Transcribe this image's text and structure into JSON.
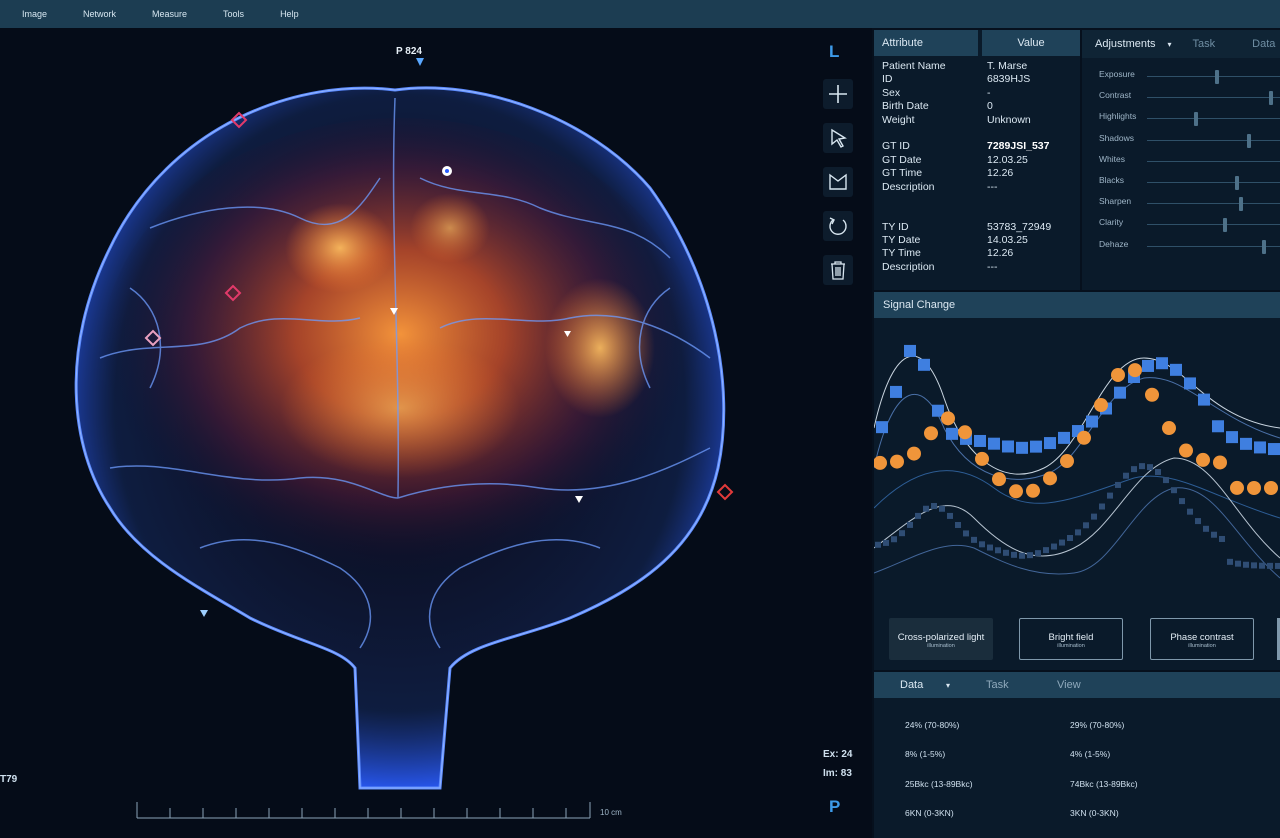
{
  "menu": [
    "Image",
    "Network",
    "Measure",
    "Tools",
    "Help"
  ],
  "viewer": {
    "top_label": "P 824",
    "side_top": "L",
    "side_bottom": "P",
    "ex": "Ex: 24",
    "im": "Im: 83",
    "left_label": "T79",
    "scale_label": "10 cm",
    "tools": [
      "plus-icon",
      "cursor-icon",
      "lasso-icon",
      "rotate-icon",
      "trash-icon"
    ]
  },
  "attributes": {
    "header_attr": "Attribute",
    "header_value": "Value",
    "group1": [
      {
        "k": "Patient Name",
        "v": "T. Marse"
      },
      {
        "k": "ID",
        "v": "6839HJS"
      },
      {
        "k": "Sex",
        "v": "-"
      },
      {
        "k": "Birth Date",
        "v": "0"
      },
      {
        "k": "Weight",
        "v": "Unknown"
      }
    ],
    "group2": [
      {
        "k": "GT ID",
        "v": "7289JSI_537"
      },
      {
        "k": "GT Date",
        "v": "12.03.25"
      },
      {
        "k": "GT Time",
        "v": "12.26"
      },
      {
        "k": "Description",
        "v": "---"
      }
    ],
    "group3": [
      {
        "k": "TY ID",
        "v": "53783_72949"
      },
      {
        "k": "TY Date",
        "v": "14.03.25"
      },
      {
        "k": "TY Time",
        "v": "12.26"
      },
      {
        "k": "Description",
        "v": "---"
      }
    ]
  },
  "adjustments": {
    "tabs": [
      "Adjustments",
      "Task",
      "Data"
    ],
    "sliders": [
      {
        "label": "Exposure",
        "value": 0.53
      },
      {
        "label": "Contrast",
        "value": 0.93
      },
      {
        "label": "Highlights",
        "value": 0.37
      },
      {
        "label": "Shadows",
        "value": 0.77
      },
      {
        "label": "Whites",
        "value": null
      },
      {
        "label": "Blacks",
        "value": 0.68
      },
      {
        "label": "Sharpen",
        "value": 0.71
      },
      {
        "label": "Clarity",
        "value": 0.59
      },
      {
        "label": "Dehaze",
        "value": 0.88
      }
    ]
  },
  "signal": {
    "title": "Signal Change",
    "buttons": [
      {
        "label": "Cross-polarized light",
        "sub": "illumination",
        "active": true
      },
      {
        "label": "Bright field",
        "sub": "illumination",
        "active": false
      },
      {
        "label": "Phase contrast",
        "sub": "illumination",
        "active": false
      }
    ]
  },
  "data": {
    "tabs": [
      "Data",
      "Task",
      "View"
    ],
    "col1": [
      "24% (70-80%)",
      "8% (1-5%)",
      "25Bkc (13-89Bkc)",
      "6KN (0-3KN)"
    ],
    "col2": [
      "29% (70-80%)",
      "4% (1-5%)",
      "74Bkc (13-89Bkc)",
      "3KN (0-3KN)"
    ]
  },
  "colors": {
    "accent_blue": "#3d9be9",
    "series_blue": "#3f7fe0",
    "series_orange": "#f0953a",
    "panel_header": "#1f4259"
  }
}
